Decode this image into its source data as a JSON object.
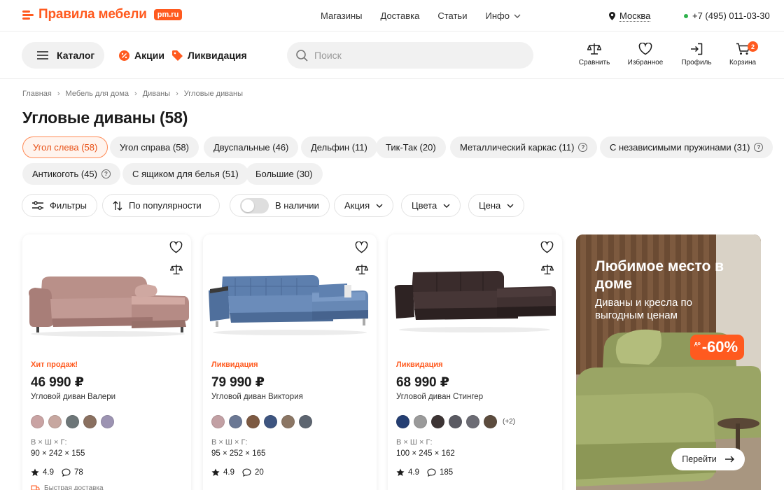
{
  "topbar": {
    "logo_text": "Правила мебели",
    "logo_badge": "pm.ru",
    "nav": [
      "Магазины",
      "Доставка",
      "Статьи",
      "Инфо"
    ],
    "city": "Москва",
    "phone": "+7 (495) 011-03-30"
  },
  "header": {
    "catalog_label": "Каталог",
    "promo_label": "Акции",
    "clearance_label": "Ликвидация",
    "search_placeholder": "Поиск",
    "actions": {
      "compare": "Сравнить",
      "favorites": "Избранное",
      "profile": "Профиль",
      "cart": "Корзина",
      "cart_count": "2"
    }
  },
  "breadcrumbs": [
    "Главная",
    "Мебель для дома",
    "Диваны",
    "Угловые диваны"
  ],
  "page_title": "Угловые диваны (58)",
  "chips": [
    "Угол слева (58)",
    "Угол справа (58)",
    "Двуспальные (46)",
    "Дельфин (11)",
    "Тик-Так (20)",
    "Металлический каркас (11)",
    "С независимыми пружинами (31)",
    "Антикоготь (45)",
    "С ящиком для белья (51)",
    "Большие (30)"
  ],
  "filters": {
    "filters_label": "Фильтры",
    "sort_label": "По популярности",
    "in_stock_label": "В наличии",
    "promo_label": "Акция",
    "colors_label": "Цвета",
    "price_label": "Цена"
  },
  "products": [
    {
      "badge": "Хит продаж!",
      "price": "46 990 ₽",
      "name": "Угловой диван Валери",
      "swatches": [
        "#c9a3a3",
        "#c7a7a0",
        "#6d7678",
        "#8a7060",
        "#9c93b2"
      ],
      "more_colors": "",
      "dim_label": "В × Ш × Г:",
      "dimensions": "90 × 242 × 155",
      "rating": "4.9",
      "reviews": "78",
      "delivery": "Быстрая доставка"
    },
    {
      "badge": "Ликвидация",
      "price": "79 990 ₽",
      "name": "Угловой диван Виктория",
      "swatches": [
        "#c2a0a4",
        "#6b7894",
        "#7d5a42",
        "#3e5580",
        "#8b7664",
        "#5d6570"
      ],
      "more_colors": "",
      "dim_label": "В × Ш × Г:",
      "dimensions": "95 × 252 × 165",
      "rating": "4.9",
      "reviews": "20"
    },
    {
      "badge": "Ликвидация",
      "price": "68 990 ₽",
      "name": "Угловой диван Стингер",
      "swatches": [
        "#243e72",
        "#9a9a9a",
        "#3c3434",
        "#5a5a62",
        "#6c6c74",
        "#5c4c3e"
      ],
      "more_colors": "(+2)",
      "dim_label": "В × Ш × Г:",
      "dimensions": "100 × 245 × 162",
      "rating": "4.9",
      "reviews": "185"
    }
  ],
  "banner": {
    "title": "Любимое место в доме",
    "subtitle": "Диваны и кресла по выгодным ценам",
    "discount_prefix": "до",
    "discount": "-60%",
    "button": "Перейти"
  },
  "colors": {
    "accent": "#ff5a1f",
    "chip_bg": "#f1f1f1",
    "text": "#1c1c1c"
  },
  "icons": [
    "hamburger-icon",
    "percent-icon",
    "tag-icon",
    "search-icon",
    "scales-icon",
    "heart-icon",
    "login-icon",
    "cart-icon",
    "location-pin-icon",
    "chevron-down-icon",
    "sliders-icon",
    "sort-icon",
    "star-icon",
    "comment-icon",
    "truck-icon",
    "arrow-right-icon"
  ]
}
